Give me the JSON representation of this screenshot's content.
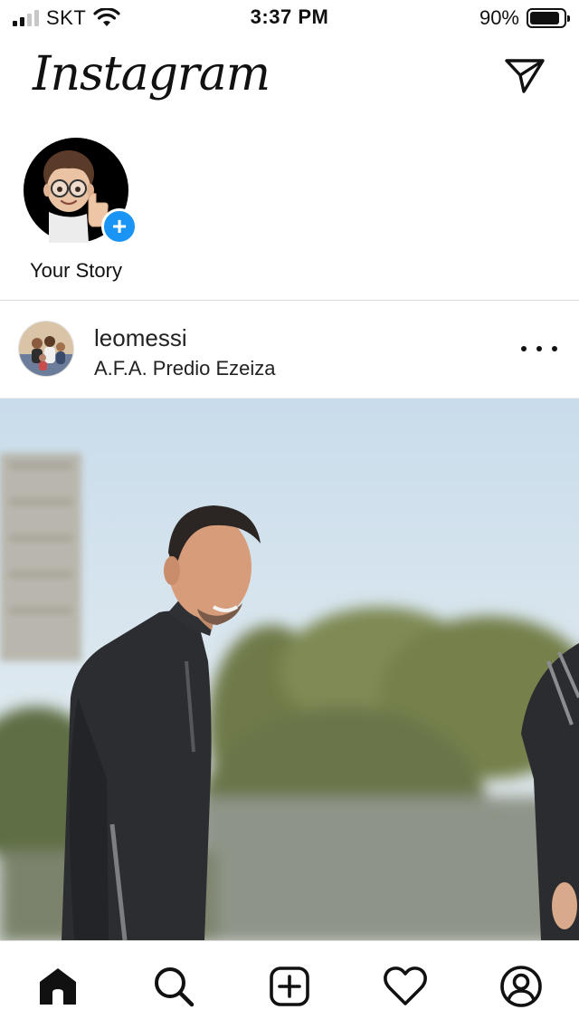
{
  "status_bar": {
    "carrier": "SKT",
    "time": "3:37 PM",
    "battery_percent_text": "90%",
    "battery_level": 0.9,
    "signal_bars": 2,
    "signal_total": 4
  },
  "header": {
    "logo_text": "Instagram",
    "direct_icon": "paper-plane-icon"
  },
  "stories": {
    "items": [
      {
        "label": "Your Story",
        "has_add_badge": true,
        "add_symbol": "+"
      }
    ]
  },
  "post": {
    "username": "leomessi",
    "location": "A.F.A. Predio Ezeiza",
    "more_icon": "more-horizontal-icon"
  },
  "tab_bar": {
    "tabs": [
      {
        "name": "home",
        "icon": "home-icon",
        "active": true
      },
      {
        "name": "search",
        "icon": "search-icon"
      },
      {
        "name": "new-post",
        "icon": "plus-square-icon"
      },
      {
        "name": "activity",
        "icon": "heart-icon"
      },
      {
        "name": "profile",
        "icon": "profile-icon"
      }
    ]
  },
  "colors": {
    "accent_blue": "#1b95f5",
    "text": "#111111",
    "divider": "#dbdbdb"
  }
}
